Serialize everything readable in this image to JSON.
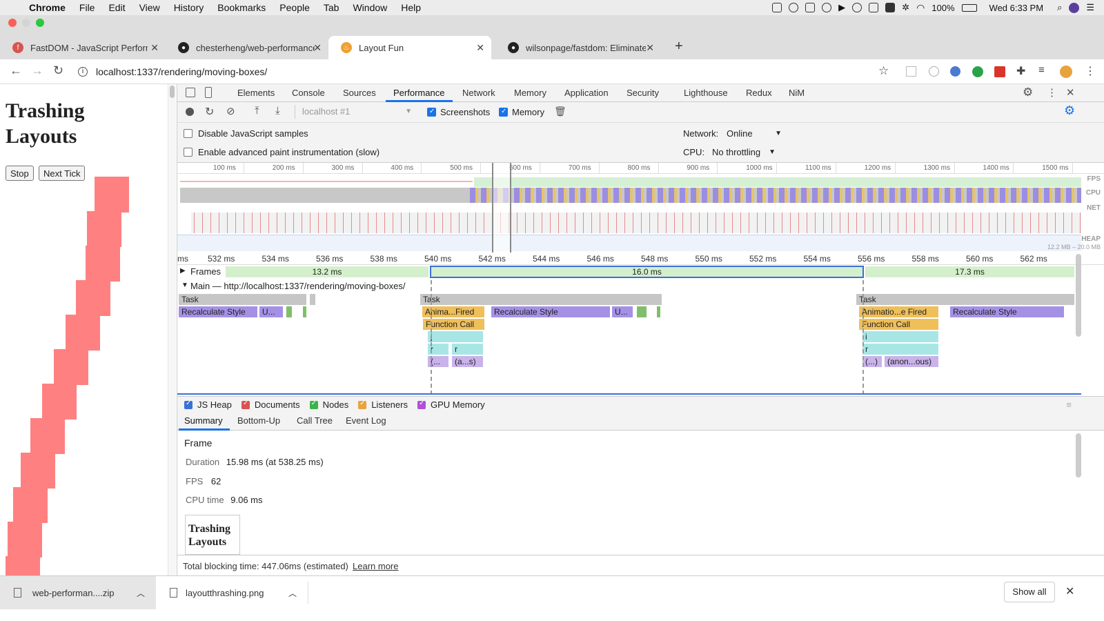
{
  "menubar": {
    "app": "Chrome",
    "items": [
      "File",
      "Edit",
      "View",
      "History",
      "Bookmarks",
      "People",
      "Tab",
      "Window",
      "Help"
    ],
    "battery": "100%",
    "clock": "Wed 6:33 PM"
  },
  "tabs": [
    {
      "title": "FastDOM - JavaScript Perform",
      "favicon": "fastdom-icon"
    },
    {
      "title": "chesterheng/web-performance",
      "favicon": "github-icon"
    },
    {
      "title": "Layout Fun",
      "favicon": "fire-icon",
      "active": true
    },
    {
      "title": "wilsonpage/fastdom: Eliminate",
      "favicon": "github-icon"
    }
  ],
  "address": {
    "url": "localhost:1337/rendering/moving-boxes/"
  },
  "page": {
    "heading_line1": "Trashing",
    "heading_line2": "Layouts",
    "stop_label": "Stop",
    "next_label": "Next Tick",
    "box_color": "#ff8080"
  },
  "devtools": {
    "tabs": [
      "Elements",
      "Console",
      "Sources",
      "Performance",
      "Network",
      "Memory",
      "Application",
      "Security",
      "Lighthouse",
      "Redux",
      "NiM"
    ],
    "active_tab": "Performance",
    "target": "localhost #1",
    "screenshots_label": "Screenshots",
    "memory_label": "Memory",
    "disable_js": "Disable JavaScript samples",
    "advanced_paint": "Enable advanced paint instrumentation (slow)",
    "network_label": "Network:",
    "network_value": "Online",
    "cpu_label": "CPU:",
    "cpu_value": "No throttling",
    "overview_ticks": [
      "100 ms",
      "200 ms",
      "300 ms",
      "400 ms",
      "500 ms",
      "600 ms",
      "700 ms",
      "800 ms",
      "900 ms",
      "1000 ms",
      "1100 ms",
      "1200 ms",
      "1300 ms",
      "1400 ms",
      "1500 ms"
    ],
    "track_labels": {
      "fps": "FPS",
      "cpu": "CPU",
      "net": "NET",
      "heap": "HEAP",
      "heap_range": "12.2 MB – 20.0 MB"
    },
    "detail_ticks": [
      "ms",
      "532 ms",
      "534 ms",
      "536 ms",
      "538 ms",
      "540 ms",
      "542 ms",
      "544 ms",
      "546 ms",
      "548 ms",
      "550 ms",
      "552 ms",
      "554 ms",
      "556 ms",
      "558 ms",
      "560 ms",
      "562 ms"
    ],
    "frames_label": "Frames",
    "frames": [
      "13.2 ms",
      "16.0 ms",
      "17.3 ms"
    ],
    "main_label": "Main — http://localhost:1337/rendering/moving-boxes/",
    "events": {
      "task": "Task",
      "recalc": "Recalculate Style",
      "u": "U...",
      "anim1": "Anima...Fired",
      "anim2": "Animatio...e Fired",
      "fcall": "Function Call",
      "j": "j",
      "i": "i",
      "r": "r",
      "paren": "(...",
      "as": "(a...s)",
      "paren2": "(...)",
      "anon": "(anon...ous)"
    },
    "legend": [
      {
        "label": "JS Heap",
        "color": "#3b6fd8"
      },
      {
        "label": "Documents",
        "color": "#d9534f"
      },
      {
        "label": "Nodes",
        "color": "#3cb44b"
      },
      {
        "label": "Listeners",
        "color": "#e8a33d"
      },
      {
        "label": "GPU Memory",
        "color": "#b04fd8"
      }
    ],
    "subtabs": [
      "Summary",
      "Bottom-Up",
      "Call Tree",
      "Event Log"
    ],
    "summary": {
      "title": "Frame",
      "duration_label": "Duration",
      "duration_value": "15.98 ms (at 538.25 ms)",
      "fps_label": "FPS",
      "fps_value": "62",
      "cpu_label": "CPU time",
      "cpu_value": "9.06 ms",
      "thumb_line1": "Trashing",
      "thumb_line2": "Layouts"
    },
    "footer": {
      "text": "Total blocking time: 447.06ms (estimated)",
      "link": "Learn more"
    }
  },
  "downloads": [
    {
      "name": "web-performan....zip"
    },
    {
      "name": "layoutthrashing.png"
    }
  ],
  "show_all": "Show all"
}
